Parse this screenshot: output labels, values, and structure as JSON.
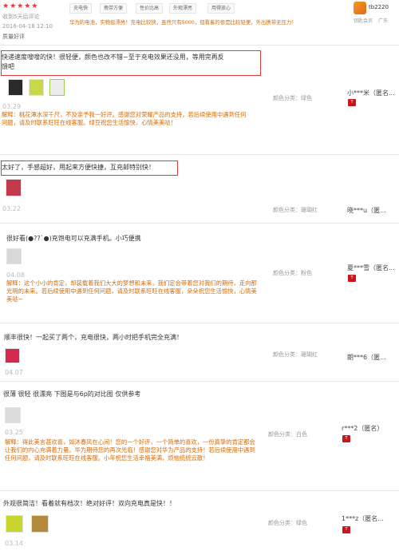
{
  "top": {
    "stars": "★★★★★",
    "meta": "收到5天后评论",
    "date": "2016-04-18 12:10",
    "tag_link": "质量好评",
    "tags": [
      "充电快",
      "携带方便",
      "性价比高",
      "外观漂亮",
      "用得放心"
    ],
    "review": "华为的电池，实物挺漂亮！充电比较快，虽然只有5000，但看着的很是比较轻便，外出携带无压力！",
    "username": "tb2220",
    "user_level": "钥匙会员",
    "user_location": "广东"
  },
  "reviews": [
    {
      "text": "快递速度嗖嗖的快！很轻便，颜色也改不错~至于充电效果还没用，等用完再反馈吧",
      "lines": [
        "快递速度嗖嗖的快！很轻便，颜色也改不错~至于充电效果还没用，等用完再反",
        "馈吧"
      ],
      "date": "03.29",
      "reply": "解释：桃花潭水深千尺，不及亲予我一好评。感谢您对荣耀产品的支持，若后续使用中遇到任何问题，请及时联系旺旺在线客服。绿豆祝您生活愉快，心情美美哒！",
      "color_label": "颜色分类：",
      "color_value": "绿色",
      "user": "小***米（匿名...",
      "thumbs": [
        "#2a2a2a",
        "#c8d84a",
        "#ececec"
      ]
    },
    {
      "text": "太好了，手感超好，用起来方便快捷，互充邮特别快！",
      "date": "03.22",
      "color_label": "颜色分类：",
      "color_value": "珊瑚红",
      "user": "晓***u（匿...",
      "thumbs": [
        "#c43a4a"
      ]
    },
    {
      "text": "很好看(●??`●)充饱电可以充满手机。小巧便携",
      "date": "04.08",
      "reply": "解释：这个小小的肯定，却装载着我们大大的梦想和未来，我们定会带着您对我们的期待，走向那光明的未来。若后续使用中遇到任何问题，请及时联系旺旺在线客服，朵朵祝您生活愉快，心情美美哒~",
      "color_label": "颜色分类：",
      "color_value": "粉色",
      "user": "夏***雪（匿名...",
      "thumbs": [
        "#d8d8d8"
      ]
    },
    {
      "text": "顺丰很快！一起买了两个，充电很快，两小时把手机完全充满！",
      "date": "04.07",
      "color_label": "颜色分类：",
      "color_value": "珊瑚红",
      "user": "朗***6（匿...",
      "thumbs": [
        "#d12a4a"
      ]
    },
    {
      "text": "很薄 很轻 很漂亮 下图是与6p的对比图 仅供参考",
      "date": "03.25",
      "reply": "解释：得此美言甚欢喜，如沐春风在心间！您的一个好评，一个简单的喜欢，一份真挚的肯定都会让我们的内心充满着力量。华为期待您的再次光临！感谢您对华为产品的支持！若后续使用中遇到任何问题，请及时联系旺旺在线客服。小年祝您生活幸福美满，烦恼统统云散！",
      "color_label": "颜色分类：",
      "color_value": "白色",
      "user": "r***2（匿名）",
      "thumbs": [
        "#dcdcdc"
      ]
    },
    {
      "text": "外观很简洁！看着就有档次！绝对好评！双向充电真是快！！",
      "date": "03.14",
      "color_label": "颜色分类：",
      "color_value": "绿色",
      "user": "1***z（匿名...",
      "thumbs": [
        "#c9d52f",
        "#b18a3a"
      ]
    }
  ],
  "badge_text": "T"
}
